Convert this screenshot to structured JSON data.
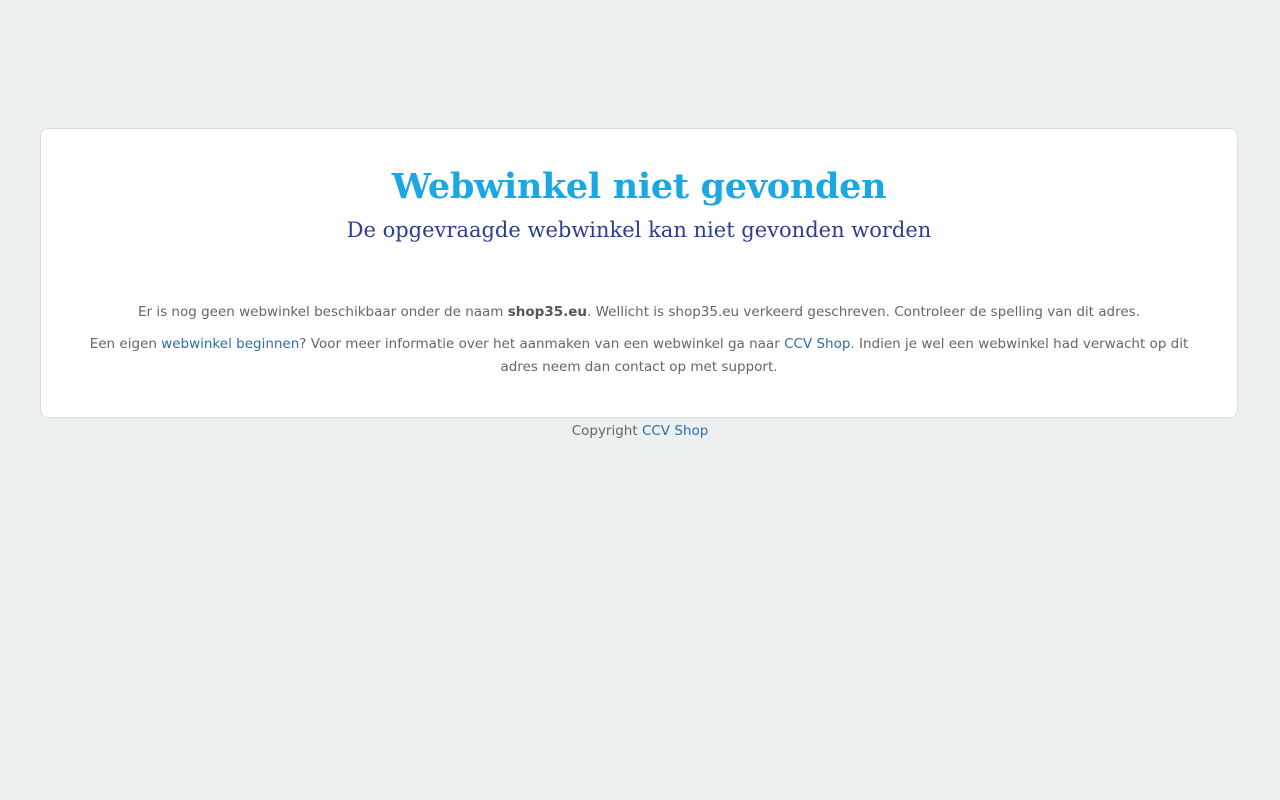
{
  "card": {
    "title": "Webwinkel niet gevonden",
    "subtitle": "De opgevraagde webwinkel kan niet gevonden worden",
    "paragraph1": {
      "text_before": "Er is nog geen webwinkel beschikbaar onder de naam ",
      "shop_name": "shop35.eu",
      "text_after": ". Wellicht is shop35.eu verkeerd geschreven. Controleer de spelling van dit adres."
    },
    "paragraph2": {
      "text_before": "Een eigen ",
      "link1_label": "webwinkel beginnen",
      "text_middle": "? Voor meer informatie over het aanmaken van een webwinkel ga naar ",
      "link2_label": "CCV Shop",
      "text_after": ". Indien je wel een webwinkel had verwacht op dit adres neem dan contact op met support."
    }
  },
  "footer": {
    "text": "Copyright ",
    "link_label": "CCV Shop"
  },
  "colors": {
    "background": "#ecf0f1",
    "title": "#1aa7e3",
    "subtitle": "#2c3e8f",
    "link": "#2e6da4",
    "body_text": "#666666"
  }
}
